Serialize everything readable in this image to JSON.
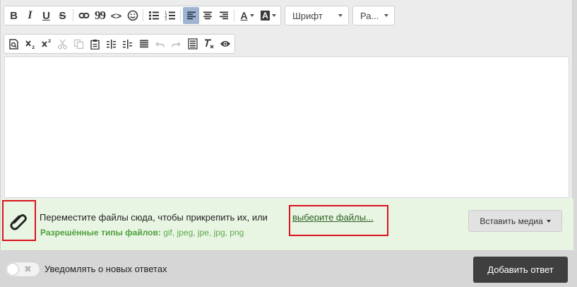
{
  "toolbar": {
    "font_dropdown": "Шрифт",
    "size_dropdown": "Ра...",
    "icons_row1": [
      "bold-icon",
      "italic-icon",
      "underline-icon",
      "strikethrough-icon",
      "link-icon",
      "quote-icon",
      "code-icon",
      "smiley-icon",
      "bulleted-list-icon",
      "numbered-list-icon",
      "align-left-icon",
      "align-center-icon",
      "align-right-icon",
      "text-color-icon",
      "background-color-icon"
    ],
    "icons_row2": [
      "preview-icon",
      "subscript-icon",
      "superscript-icon",
      "cut-icon",
      "copy-icon",
      "paste-icon",
      "indent-decrease-icon",
      "indent-increase-icon",
      "justify-icon",
      "undo-icon",
      "redo-icon",
      "paste-from-word-icon",
      "remove-format-icon",
      "eye-icon"
    ],
    "glyphs": {
      "bold": "B",
      "italic": "I",
      "underline": "U",
      "strike": "S",
      "quote": "99",
      "code": "<>",
      "text_color": "A",
      "bg_color": "A"
    }
  },
  "attachments": {
    "drop_text": "Переместите файлы сюда, чтобы прикрепить их, или",
    "choose_link": "выберите файлы...",
    "types_label": "Разрешённые типы файлов:",
    "types_value": "gif, jpeg, jpe, jpg, png",
    "insert_media": "Вставить медиа"
  },
  "footer": {
    "toggle_x": "✖",
    "notify_label": "Уведомлять о новых ответах",
    "submit_label": "Добавить ответ"
  },
  "colors": {
    "accent_red": "#d9131f",
    "attach_bg": "#e9f5e3",
    "submit_bg": "#3f3f3f",
    "active_btn": "#9fb4d1"
  }
}
